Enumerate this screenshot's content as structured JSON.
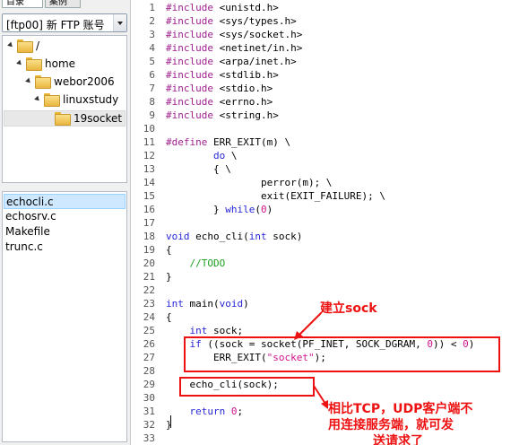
{
  "sidebar": {
    "tabs": [
      "目录",
      "案例"
    ],
    "site_select": "[ftp00] 新 FTP 账号",
    "tree": [
      {
        "label": "/",
        "depth": 0,
        "expanded": true,
        "selected": false
      },
      {
        "label": "home",
        "depth": 1,
        "expanded": true,
        "selected": false
      },
      {
        "label": "webor2006",
        "depth": 2,
        "expanded": true,
        "selected": false
      },
      {
        "label": "linuxstudy",
        "depth": 3,
        "expanded": true,
        "selected": false
      },
      {
        "label": "19socket",
        "depth": 4,
        "expanded": false,
        "selected": true
      }
    ],
    "files": [
      {
        "name": "echocli.c",
        "selected": true
      },
      {
        "name": "echosrv.c",
        "selected": false
      },
      {
        "name": "Makefile",
        "selected": false
      },
      {
        "name": "trunc.c",
        "selected": false
      }
    ]
  },
  "editor": {
    "lines": [
      [
        [
          "pp",
          "#include "
        ],
        [
          "",
          "<unistd.h>"
        ]
      ],
      [
        [
          "pp",
          "#include "
        ],
        [
          "",
          "<sys/types.h>"
        ]
      ],
      [
        [
          "pp",
          "#include "
        ],
        [
          "",
          "<sys/socket.h>"
        ]
      ],
      [
        [
          "pp",
          "#include "
        ],
        [
          "",
          "<netinet/in.h>"
        ]
      ],
      [
        [
          "pp",
          "#include "
        ],
        [
          "",
          "<arpa/inet.h>"
        ]
      ],
      [
        [
          "pp",
          "#include "
        ],
        [
          "",
          "<stdlib.h>"
        ]
      ],
      [
        [
          "pp",
          "#include "
        ],
        [
          "",
          "<stdio.h>"
        ]
      ],
      [
        [
          "pp",
          "#include "
        ],
        [
          "",
          "<errno.h>"
        ]
      ],
      [
        [
          "pp",
          "#include "
        ],
        [
          "",
          "<string.h>"
        ]
      ],
      [],
      [
        [
          "pp",
          "#define "
        ],
        [
          "",
          "ERR_EXIT(m) \\"
        ]
      ],
      [
        [
          "",
          "        "
        ],
        [
          "kw",
          "do"
        ],
        [
          "",
          " \\"
        ]
      ],
      [
        [
          "",
          "        { \\"
        ]
      ],
      [
        [
          "",
          "                perror(m); \\"
        ]
      ],
      [
        [
          "",
          "                exit(EXIT_FAILURE); \\"
        ]
      ],
      [
        [
          "",
          "        } "
        ],
        [
          "kw",
          "while"
        ],
        [
          "",
          "("
        ],
        [
          "nu",
          "0"
        ],
        [
          "",
          ")"
        ]
      ],
      [],
      [
        [
          "kw",
          "void"
        ],
        [
          "",
          " echo_cli("
        ],
        [
          "kw",
          "int"
        ],
        [
          "",
          " sock)"
        ]
      ],
      [
        [
          "",
          "{"
        ]
      ],
      [
        [
          "",
          "    "
        ],
        [
          "cm",
          "//TODO"
        ]
      ],
      [
        [
          "",
          "}"
        ]
      ],
      [],
      [
        [
          "kw",
          "int"
        ],
        [
          "",
          " main("
        ],
        [
          "kw",
          "void"
        ],
        [
          "",
          ")"
        ]
      ],
      [
        [
          "",
          "{"
        ]
      ],
      [
        [
          "",
          "    "
        ],
        [
          "kw",
          "int"
        ],
        [
          "",
          " sock;"
        ]
      ],
      [
        [
          "",
          "    "
        ],
        [
          "kw",
          "if"
        ],
        [
          "",
          " ((sock = socket(PF_INET, SOCK_DGRAM, "
        ],
        [
          "nu",
          "0"
        ],
        [
          "",
          ")) < "
        ],
        [
          "nu",
          "0"
        ],
        [
          "",
          ")"
        ]
      ],
      [
        [
          "",
          "        ERR_EXIT("
        ],
        [
          "st",
          "\"socket\""
        ],
        [
          "",
          ");"
        ]
      ],
      [],
      [
        [
          "",
          "    echo_cli(sock);"
        ]
      ],
      [],
      [
        [
          "",
          "    "
        ],
        [
          "kw",
          "return"
        ],
        [
          "",
          " "
        ],
        [
          "nu",
          "0"
        ],
        [
          "",
          ";"
        ]
      ],
      [
        [
          "",
          "}"
        ]
      ],
      []
    ]
  },
  "annotations": {
    "label1": "建立sock",
    "label2_lines": [
      "相比TCP，UDP客户端不",
      "用连接服务端，就可发",
      "送请求了"
    ]
  },
  "colors": {
    "annotation": "#ee1111",
    "preprocessor": "#a0208f",
    "keyword": "#2727d8",
    "comment": "#20a020",
    "string": "#d0148c"
  }
}
